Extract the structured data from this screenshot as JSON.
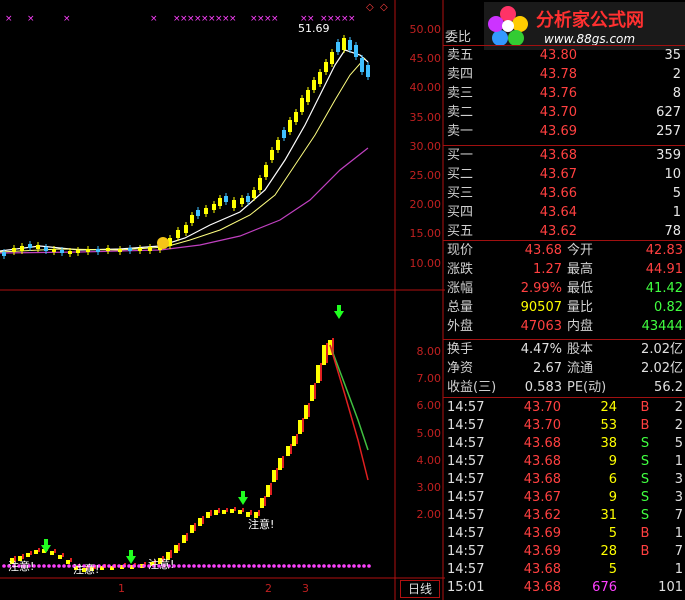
{
  "price_axis": [
    "50.00",
    "45.00",
    "40.00",
    "35.00",
    "30.00",
    "25.00",
    "20.00",
    "15.00",
    "10.00"
  ],
  "indicator_axis": [
    "8.00",
    "7.00",
    "6.00",
    "5.00",
    "4.00",
    "3.00",
    "2.00"
  ],
  "date_ticks": [
    "1",
    "2",
    "3"
  ],
  "period_tab": "日线",
  "chart_annotations": {
    "high_price": "51.69",
    "note_label": "注意!"
  },
  "logo": {
    "text": "分析家公式网",
    "url": "www.88gs.com"
  },
  "order_book": {
    "title": "委比",
    "asks": [
      {
        "label": "卖五",
        "price": "43.80",
        "vol": "35"
      },
      {
        "label": "卖四",
        "price": "43.78",
        "vol": "2"
      },
      {
        "label": "卖三",
        "price": "43.76",
        "vol": "8"
      },
      {
        "label": "卖二",
        "price": "43.70",
        "vol": "627"
      },
      {
        "label": "卖一",
        "price": "43.69",
        "vol": "257"
      }
    ],
    "bids": [
      {
        "label": "买一",
        "price": "43.68",
        "vol": "359"
      },
      {
        "label": "买二",
        "price": "43.67",
        "vol": "10"
      },
      {
        "label": "买三",
        "price": "43.66",
        "vol": "5"
      },
      {
        "label": "买四",
        "price": "43.64",
        "vol": "1"
      },
      {
        "label": "买五",
        "price": "43.62",
        "vol": "78"
      }
    ]
  },
  "quote": [
    {
      "l1": "现价",
      "v1": "43.68",
      "c1": "#ff4040",
      "l2": "今开",
      "v2": "42.83",
      "c2": "#ff4040"
    },
    {
      "l1": "涨跌",
      "v1": "1.27",
      "c1": "#ff4040",
      "l2": "最高",
      "v2": "44.91",
      "c2": "#ff4040"
    },
    {
      "l1": "涨幅",
      "v1": "2.99%",
      "c1": "#ff4040",
      "l2": "最低",
      "v2": "41.42",
      "c2": "#40ff40"
    },
    {
      "l1": "总量",
      "v1": "90507",
      "c1": "#ffff00",
      "l2": "量比",
      "v2": "0.82",
      "c2": "#40ff40"
    },
    {
      "l1": "外盘",
      "v1": "47063",
      "c1": "#ff4040",
      "l2": "内盘",
      "v2": "43444",
      "c2": "#40ff40"
    }
  ],
  "fundamentals": [
    {
      "l1": "换手",
      "v1": "4.47%",
      "l2": "股本",
      "v2": "2.02亿"
    },
    {
      "l1": "净资",
      "v1": "2.67",
      "l2": "流通",
      "v2": "2.02亿"
    },
    {
      "l1": "收益(三)",
      "v1": "0.583",
      "l2": "PE(动)",
      "v2": "56.2"
    }
  ],
  "ticks": [
    {
      "time": "14:57",
      "price": "43.70",
      "vol": "24",
      "side": "B",
      "cnt": "2"
    },
    {
      "time": "14:57",
      "price": "43.70",
      "vol": "53",
      "side": "B",
      "cnt": "2"
    },
    {
      "time": "14:57",
      "price": "43.68",
      "vol": "38",
      "side": "S",
      "cnt": "5"
    },
    {
      "time": "14:57",
      "price": "43.68",
      "vol": "9",
      "side": "S",
      "cnt": "1"
    },
    {
      "time": "14:57",
      "price": "43.68",
      "vol": "6",
      "side": "S",
      "cnt": "3"
    },
    {
      "time": "14:57",
      "price": "43.67",
      "vol": "9",
      "side": "S",
      "cnt": "3"
    },
    {
      "time": "14:57",
      "price": "43.62",
      "vol": "31",
      "side": "S",
      "cnt": "7"
    },
    {
      "time": "14:57",
      "price": "43.69",
      "vol": "5",
      "side": "B",
      "cnt": "1"
    },
    {
      "time": "14:57",
      "price": "43.69",
      "vol": "28",
      "side": "B",
      "cnt": "7"
    },
    {
      "time": "14:57",
      "price": "43.68",
      "vol": "5",
      "side": "",
      "cnt": "1"
    },
    {
      "time": "15:01",
      "price": "43.68",
      "vol": "676",
      "side": "",
      "cnt": "101"
    }
  ],
  "colors": {
    "up": "#ff4040",
    "down": "#40ff40",
    "border": "#b01010",
    "yellow": "#ffff00",
    "magenta": "#ff40ff"
  }
}
